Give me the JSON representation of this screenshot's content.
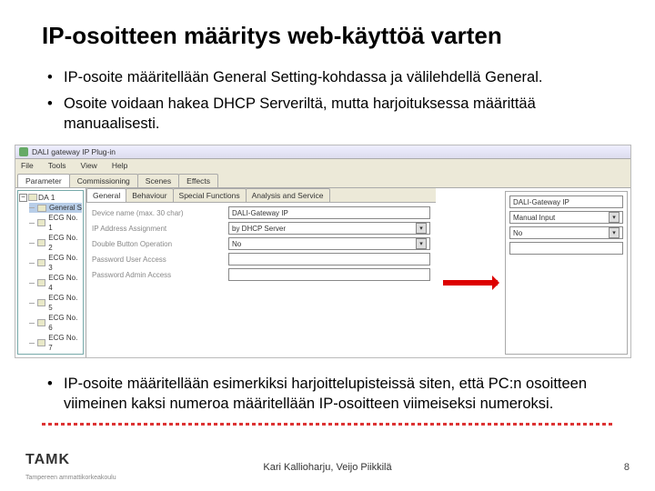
{
  "title": "IP-osoitteen määritys web-käyttöä varten",
  "bullets": {
    "b1": "IP-osoite määritellään General Setting-kohdassa ja välilehdellä General.",
    "b2": "Osoite voidaan hakea DHCP Serveriltä, mutta harjoituksessa määrittää manuaalisesti.",
    "b3": "IP-osoite määritellään esimerkiksi harjoittelupisteissä siten, että PC:n osoitteen viimeinen kaksi numeroa määritellään IP-osoitteen viimeiseksi numeroksi."
  },
  "app": {
    "title": "DALI gateway IP Plug-in",
    "menus": {
      "m0": "File",
      "m1": "Tools",
      "m2": "View",
      "m3": "Help"
    },
    "tabs": {
      "t0": "Parameter",
      "t1": "Commissioning",
      "t2": "Scenes",
      "t3": "Effects"
    },
    "tree": {
      "root": "DA 1",
      "items": {
        "i0": "General S",
        "i1": "ECG No. 1",
        "i2": "ECG No. 2",
        "i3": "ECG No. 3",
        "i4": "ECG No. 4",
        "i5": "ECG No. 5",
        "i6": "ECG No. 6",
        "i7": "ECG No. 7"
      }
    },
    "subtabs": {
      "s0": "General",
      "s1": "Behaviour",
      "s2": "Special Functions",
      "s3": "Analysis and Service"
    },
    "form": {
      "r0": {
        "label": "Device name (max. 30 char)",
        "value": "DALI-Gateway IP"
      },
      "r1": {
        "label": "IP Address Assignment",
        "value": "by DHCP Server"
      },
      "r2": {
        "label": "Double Button Operation",
        "value": "No"
      },
      "r3": {
        "label": "Password User Access",
        "value": ""
      },
      "r4": {
        "label": "Password Admin Access",
        "value": ""
      }
    },
    "inset": {
      "r0": "DALI-Gateway IP",
      "r1": "Manual Input",
      "r2": "No",
      "r3": ""
    }
  },
  "footer": {
    "logo_main": "TAMK",
    "logo_sub": "Tampereen ammattikorkeakoulu",
    "authors": "Kari Kallioharju, Veijo Piikkilä",
    "page": "8"
  }
}
